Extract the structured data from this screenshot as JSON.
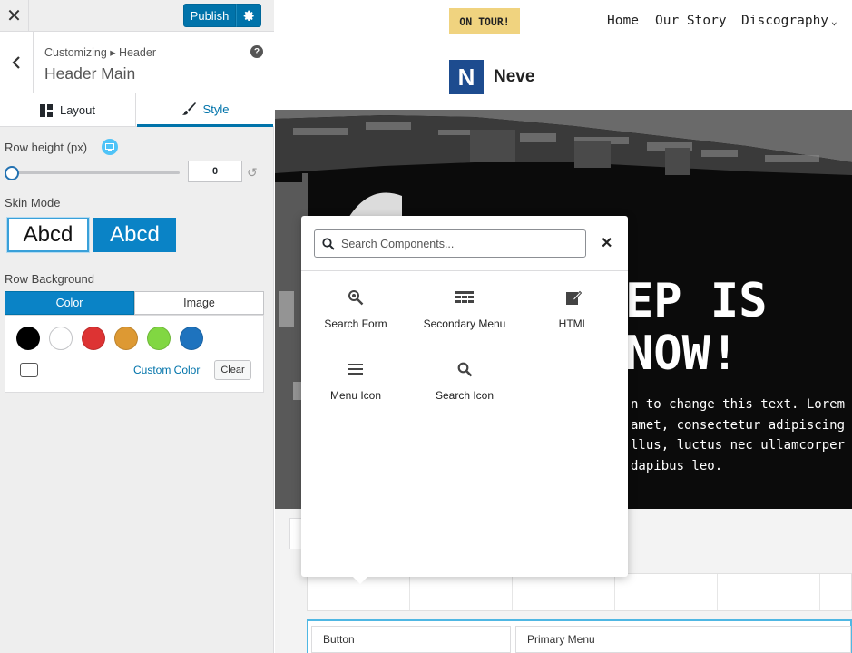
{
  "toolbar": {
    "close_glyph": "✕",
    "publish_label": "Publish",
    "settings_icon": "gear-icon"
  },
  "section": {
    "breadcrumb": "Customizing ▸ Header",
    "title": "Header Main",
    "help_glyph": "?"
  },
  "tabs": [
    {
      "label": "Layout",
      "icon": "layout-icon"
    },
    {
      "label": "Style",
      "icon": "brush-icon",
      "active": true
    }
  ],
  "row_height": {
    "label": "Row height (px)",
    "value": "0",
    "slider_fraction": 0
  },
  "skin_mode": {
    "label": "Skin Mode",
    "light_label": "Abcd",
    "dark_label": "Abcd",
    "selected": "light"
  },
  "row_background": {
    "label": "Row Background",
    "tabs": [
      "Color",
      "Image"
    ],
    "active_tab": "Color",
    "swatches": [
      "#000000",
      "#ffffff",
      "#dd3333",
      "#dd9933",
      "#81d742",
      "#1e73be"
    ],
    "custom_color_label": "Custom Color",
    "clear_label": "Clear"
  },
  "preview": {
    "tour_badge": "ON TOUR!",
    "nav": [
      "Home",
      "Our Story",
      "Discography"
    ],
    "logo_letter": "N",
    "logo_text": "Neve",
    "hero_lines": [
      "EP IS",
      "NOW!"
    ],
    "hero_text": [
      "n to change this text. Lorem",
      "amet, consectetur adipiscing",
      "llus, luctus nec ullamcorper",
      "dapibus leo."
    ],
    "builder_items": [
      "Button",
      "Primary Menu"
    ]
  },
  "popup": {
    "search_placeholder": "Search Components...",
    "close_glyph": "✕",
    "components": [
      {
        "label": "Search Form",
        "icon": "search-form-icon"
      },
      {
        "label": "Secondary Menu",
        "icon": "secondary-menu-icon"
      },
      {
        "label": "HTML",
        "icon": "html-edit-icon"
      },
      {
        "label": "Menu Icon",
        "icon": "hamburger-menu-icon"
      },
      {
        "label": "Search Icon",
        "icon": "search-icon"
      }
    ]
  },
  "colors": {
    "accent": "#0073aa",
    "info_dot": "#4fc3f7",
    "tour_badge": "#f0d37f",
    "logo": "#1d4c8f"
  }
}
